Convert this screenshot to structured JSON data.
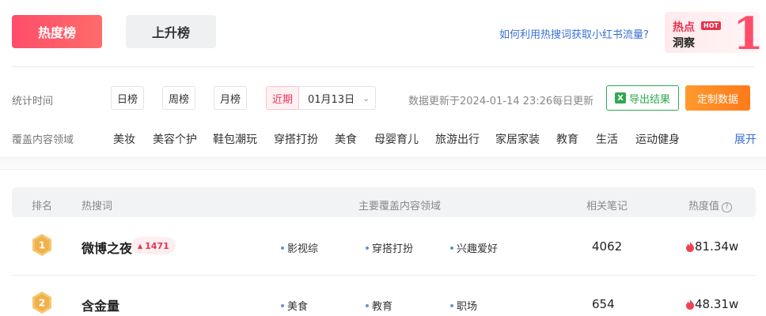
{
  "tabs": {
    "hot": "热度榜",
    "rise": "上升榜"
  },
  "help_link": "如何利用热搜词获取小红书流量?",
  "insight": {
    "line1": "热点",
    "badge": "HOT",
    "line2": "洞察",
    "numeral": "1"
  },
  "filters": {
    "time_label": "统计时间",
    "periods": [
      "日榜",
      "周榜",
      "月榜"
    ],
    "recent_label": "近期",
    "date_value": "01月13日",
    "update_text": "数据更新于2024-01-14 23:26每日更新",
    "export_label": "导出结果",
    "export_icon": "X",
    "custom_label": "定制数据",
    "domain_label": "覆盖内容领域",
    "categories": [
      "美妆",
      "美容个护",
      "鞋包潮玩",
      "穿搭打扮",
      "美食",
      "母婴育儿",
      "旅游出行",
      "家居家装",
      "教育",
      "生活",
      "运动健身"
    ],
    "expand_label": "展开"
  },
  "table": {
    "headers": {
      "rank": "排名",
      "keyword": "热搜词",
      "domains": "主要覆盖内容领域",
      "notes": "相关笔记",
      "heat": "热度值"
    },
    "rows": [
      {
        "rank": "1",
        "keyword": "微博之夜",
        "rise": "1471",
        "domains": [
          "影视综",
          "穿搭打扮",
          "兴趣爱好"
        ],
        "notes": "4062",
        "heat": "81.34w"
      },
      {
        "rank": "2",
        "keyword": "含金量",
        "rise": "",
        "domains": [
          "美食",
          "教育",
          "职场"
        ],
        "notes": "654",
        "heat": "48.31w"
      }
    ]
  },
  "colors": {
    "accent": "#ff4d6a",
    "link": "#3a6fd8",
    "export_green": "#2fa84f",
    "custom_orange": "#ff8a24",
    "medal_gold": "#f2b04a"
  }
}
